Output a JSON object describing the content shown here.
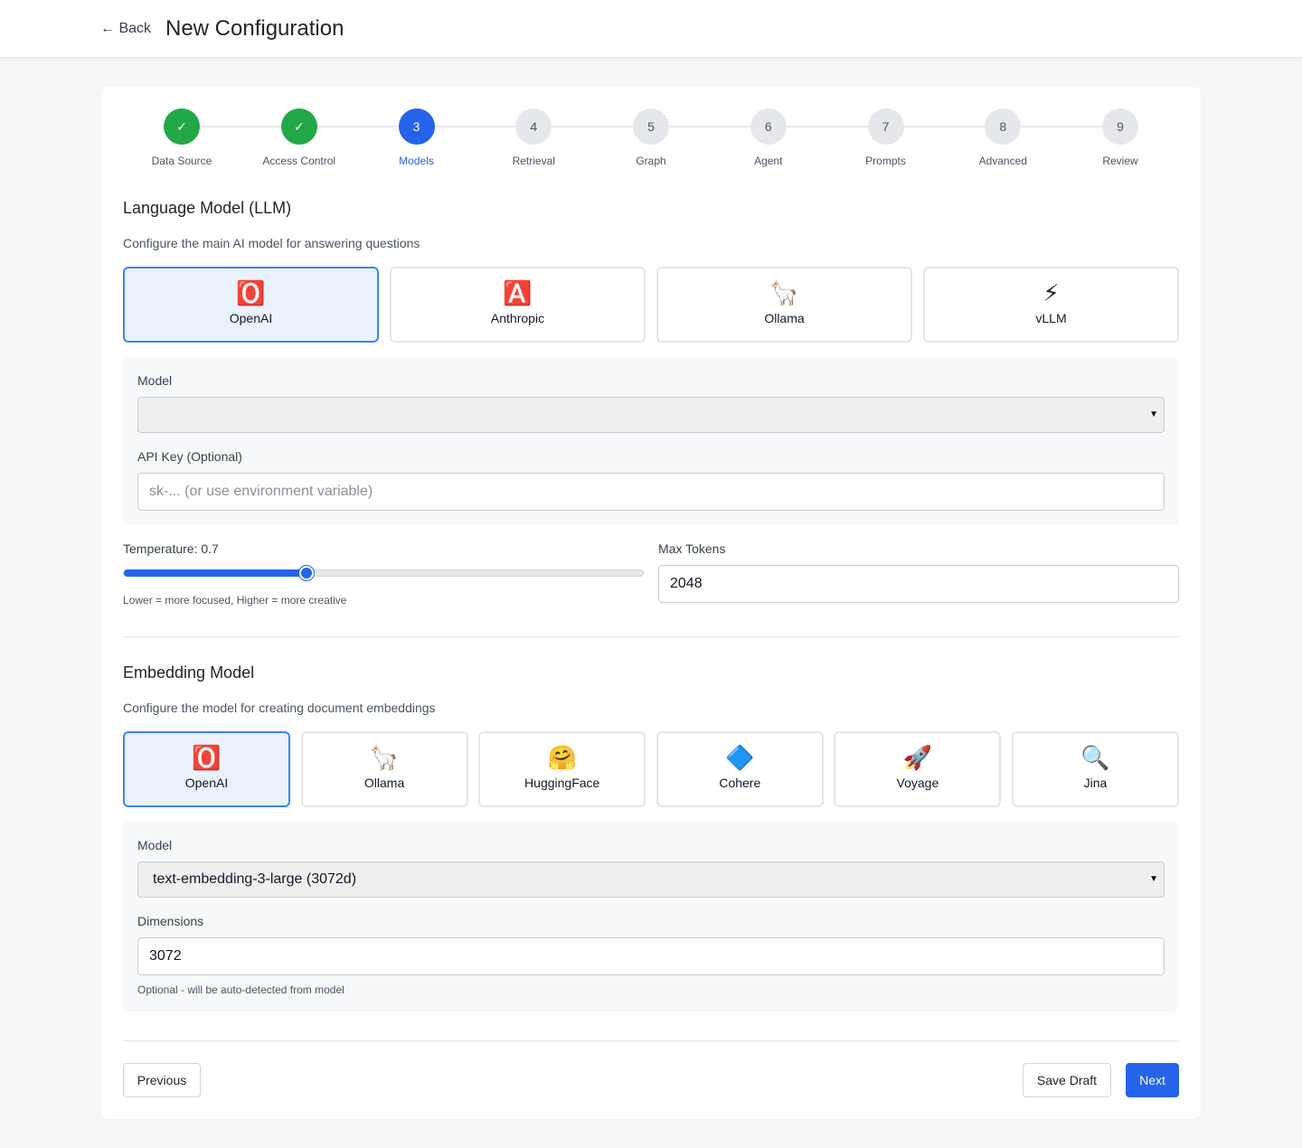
{
  "header": {
    "back_label": "← Back",
    "title": "New Configuration"
  },
  "steps": [
    {
      "num": "✓",
      "label": "Data Source",
      "state": "done"
    },
    {
      "num": "✓",
      "label": "Access Control",
      "state": "done"
    },
    {
      "num": "3",
      "label": "Models",
      "state": "active"
    },
    {
      "num": "4",
      "label": "Retrieval",
      "state": "pending"
    },
    {
      "num": "5",
      "label": "Graph",
      "state": "pending"
    },
    {
      "num": "6",
      "label": "Agent",
      "state": "pending"
    },
    {
      "num": "7",
      "label": "Prompts",
      "state": "pending"
    },
    {
      "num": "8",
      "label": "Advanced",
      "state": "pending"
    },
    {
      "num": "9",
      "label": "Review",
      "state": "pending"
    }
  ],
  "llm": {
    "title": "Language Model (LLM)",
    "description": "Configure the main AI model for answering questions",
    "providers": [
      {
        "icon": "🅾️",
        "label": "OpenAI",
        "selected": true
      },
      {
        "icon": "🅰️",
        "label": "Anthropic",
        "selected": false
      },
      {
        "icon": "🦙",
        "label": "Ollama",
        "selected": false
      },
      {
        "icon": "⚡",
        "label": "vLLM",
        "selected": false
      }
    ],
    "model_label": "Model",
    "model_value": "",
    "api_key_label": "API Key (Optional)",
    "api_key_placeholder": "sk-... (or use environment variable)",
    "temperature_label": "Temperature: 0.7",
    "temperature_value": 0.7,
    "temperature_max": 2,
    "temperature_hint": "Lower = more focused, Higher = more creative",
    "max_tokens_label": "Max Tokens",
    "max_tokens_value": "2048"
  },
  "embedding": {
    "title": "Embedding Model",
    "description": "Configure the model for creating document embeddings",
    "providers": [
      {
        "icon": "🅾️",
        "label": "OpenAI",
        "selected": true
      },
      {
        "icon": "🦙",
        "label": "Ollama",
        "selected": false
      },
      {
        "icon": "🤗",
        "label": "HuggingFace",
        "selected": false
      },
      {
        "icon": "🔷",
        "label": "Cohere",
        "selected": false
      },
      {
        "icon": "🚀",
        "label": "Voyage",
        "selected": false
      },
      {
        "icon": "🔍",
        "label": "Jina",
        "selected": false
      }
    ],
    "model_label": "Model",
    "model_value": "text-embedding-3-large (3072d)",
    "dimensions_label": "Dimensions",
    "dimensions_value": "3072",
    "dimensions_hint": "Optional - will be auto-detected from model"
  },
  "footer": {
    "previous_label": "Previous",
    "save_draft_label": "Save Draft",
    "next_label": "Next"
  },
  "colors": {
    "accent": "#2563eb",
    "done": "#22a846",
    "selected_bg": "#eaf2fe"
  }
}
